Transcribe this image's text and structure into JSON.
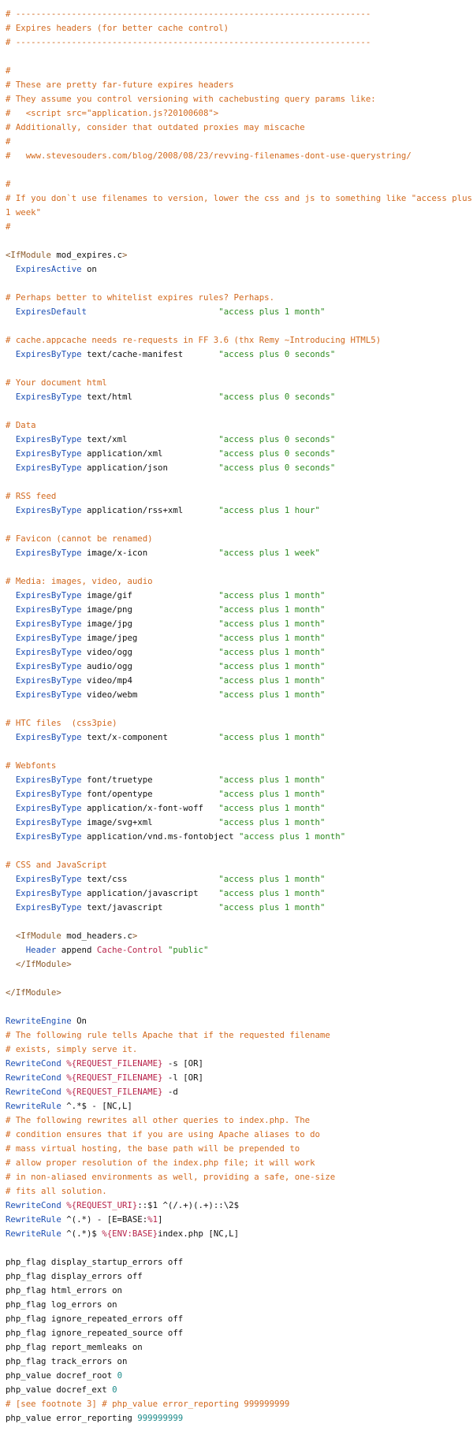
{
  "colors": {
    "comment": "#d2691e",
    "directive": "#1c4fb4",
    "string": "#2e8b22",
    "tag": "#8b5a2b",
    "number": "#1a8a8a",
    "variable": "#b8234a",
    "text": "#111111",
    "background": "#ffffff"
  },
  "lines": [
    [
      {
        "k": "c",
        "t": "# ----------------------------------------------------------------------"
      }
    ],
    [
      {
        "k": "c",
        "t": "# Expires headers (for better cache control)"
      }
    ],
    [
      {
        "k": "c",
        "t": "# ----------------------------------------------------------------------"
      }
    ],
    [],
    [
      {
        "k": "c",
        "t": "#"
      }
    ],
    [
      {
        "k": "c",
        "t": "# These are pretty far-future expires headers"
      }
    ],
    [
      {
        "k": "c",
        "t": "# They assume you control versioning with cachebusting query params like:"
      }
    ],
    [
      {
        "k": "c",
        "t": "#   <script src=\"application.js?20100608\">"
      }
    ],
    [
      {
        "k": "c",
        "t": "# Additionally, consider that outdated proxies may miscache"
      }
    ],
    [
      {
        "k": "c",
        "t": "#"
      }
    ],
    [
      {
        "k": "c",
        "t": "#   www.stevesouders.com/blog/2008/08/23/revving-filenames-dont-use-querystring/"
      }
    ],
    [],
    [
      {
        "k": "c",
        "t": "#"
      }
    ],
    [
      {
        "k": "c",
        "t": "# If you don`t use filenames to version, lower the css and js to something like \"access plus 1 week\""
      }
    ],
    [
      {
        "k": "c",
        "t": "#"
      }
    ],
    [],
    [
      {
        "k": "p",
        "t": "<IfModule"
      },
      {
        "k": "t",
        "t": " mod_expires.c"
      },
      {
        "k": "p",
        "t": ">"
      }
    ],
    [
      {
        "k": "t",
        "t": "  "
      },
      {
        "k": "k",
        "t": "ExpiresActive"
      },
      {
        "k": "t",
        "t": " on"
      }
    ],
    [],
    [
      {
        "k": "c",
        "t": "# Perhaps better to whitelist expires rules? Perhaps."
      }
    ],
    [
      {
        "k": "t",
        "t": "  "
      },
      {
        "k": "k",
        "t": "ExpiresDefault"
      },
      {
        "k": "t",
        "t": "                          "
      },
      {
        "k": "s",
        "t": "\"access plus 1 month\""
      }
    ],
    [],
    [
      {
        "k": "c",
        "t": "# cache.appcache needs re-requests in FF 3.6 (thx Remy ~Introducing HTML5)"
      }
    ],
    [
      {
        "k": "t",
        "t": "  "
      },
      {
        "k": "k",
        "t": "ExpiresByType"
      },
      {
        "k": "t",
        "t": " text/cache-manifest       "
      },
      {
        "k": "s",
        "t": "\"access plus 0 seconds\""
      }
    ],
    [],
    [
      {
        "k": "c",
        "t": "# Your document html"
      }
    ],
    [
      {
        "k": "t",
        "t": "  "
      },
      {
        "k": "k",
        "t": "ExpiresByType"
      },
      {
        "k": "t",
        "t": " text/html                 "
      },
      {
        "k": "s",
        "t": "\"access plus 0 seconds\""
      }
    ],
    [],
    [
      {
        "k": "c",
        "t": "# Data"
      }
    ],
    [
      {
        "k": "t",
        "t": "  "
      },
      {
        "k": "k",
        "t": "ExpiresByType"
      },
      {
        "k": "t",
        "t": " text/xml                  "
      },
      {
        "k": "s",
        "t": "\"access plus 0 seconds\""
      }
    ],
    [
      {
        "k": "t",
        "t": "  "
      },
      {
        "k": "k",
        "t": "ExpiresByType"
      },
      {
        "k": "t",
        "t": " application/xml           "
      },
      {
        "k": "s",
        "t": "\"access plus 0 seconds\""
      }
    ],
    [
      {
        "k": "t",
        "t": "  "
      },
      {
        "k": "k",
        "t": "ExpiresByType"
      },
      {
        "k": "t",
        "t": " application/json          "
      },
      {
        "k": "s",
        "t": "\"access plus 0 seconds\""
      }
    ],
    [],
    [
      {
        "k": "c",
        "t": "# RSS feed"
      }
    ],
    [
      {
        "k": "t",
        "t": "  "
      },
      {
        "k": "k",
        "t": "ExpiresByType"
      },
      {
        "k": "t",
        "t": " application/rss+xml       "
      },
      {
        "k": "s",
        "t": "\"access plus 1 hour\""
      }
    ],
    [],
    [
      {
        "k": "c",
        "t": "# Favicon (cannot be renamed)"
      }
    ],
    [
      {
        "k": "t",
        "t": "  "
      },
      {
        "k": "k",
        "t": "ExpiresByType"
      },
      {
        "k": "t",
        "t": " image/x-icon              "
      },
      {
        "k": "s",
        "t": "\"access plus 1 week\""
      }
    ],
    [],
    [
      {
        "k": "c",
        "t": "# Media: images, video, audio"
      }
    ],
    [
      {
        "k": "t",
        "t": "  "
      },
      {
        "k": "k",
        "t": "ExpiresByType"
      },
      {
        "k": "t",
        "t": " image/gif                 "
      },
      {
        "k": "s",
        "t": "\"access plus 1 month\""
      }
    ],
    [
      {
        "k": "t",
        "t": "  "
      },
      {
        "k": "k",
        "t": "ExpiresByType"
      },
      {
        "k": "t",
        "t": " image/png                 "
      },
      {
        "k": "s",
        "t": "\"access plus 1 month\""
      }
    ],
    [
      {
        "k": "t",
        "t": "  "
      },
      {
        "k": "k",
        "t": "ExpiresByType"
      },
      {
        "k": "t",
        "t": " image/jpg                 "
      },
      {
        "k": "s",
        "t": "\"access plus 1 month\""
      }
    ],
    [
      {
        "k": "t",
        "t": "  "
      },
      {
        "k": "k",
        "t": "ExpiresByType"
      },
      {
        "k": "t",
        "t": " image/jpeg                "
      },
      {
        "k": "s",
        "t": "\"access plus 1 month\""
      }
    ],
    [
      {
        "k": "t",
        "t": "  "
      },
      {
        "k": "k",
        "t": "ExpiresByType"
      },
      {
        "k": "t",
        "t": " video/ogg                 "
      },
      {
        "k": "s",
        "t": "\"access plus 1 month\""
      }
    ],
    [
      {
        "k": "t",
        "t": "  "
      },
      {
        "k": "k",
        "t": "ExpiresByType"
      },
      {
        "k": "t",
        "t": " audio/ogg                 "
      },
      {
        "k": "s",
        "t": "\"access plus 1 month\""
      }
    ],
    [
      {
        "k": "t",
        "t": "  "
      },
      {
        "k": "k",
        "t": "ExpiresByType"
      },
      {
        "k": "t",
        "t": " video/mp4                 "
      },
      {
        "k": "s",
        "t": "\"access plus 1 month\""
      }
    ],
    [
      {
        "k": "t",
        "t": "  "
      },
      {
        "k": "k",
        "t": "ExpiresByType"
      },
      {
        "k": "t",
        "t": " video/webm                "
      },
      {
        "k": "s",
        "t": "\"access plus 1 month\""
      }
    ],
    [],
    [
      {
        "k": "c",
        "t": "# HTC files  (css3pie)"
      }
    ],
    [
      {
        "k": "t",
        "t": "  "
      },
      {
        "k": "k",
        "t": "ExpiresByType"
      },
      {
        "k": "t",
        "t": " text/x-component          "
      },
      {
        "k": "s",
        "t": "\"access plus 1 month\""
      }
    ],
    [],
    [
      {
        "k": "c",
        "t": "# Webfonts"
      }
    ],
    [
      {
        "k": "t",
        "t": "  "
      },
      {
        "k": "k",
        "t": "ExpiresByType"
      },
      {
        "k": "t",
        "t": " font/truetype             "
      },
      {
        "k": "s",
        "t": "\"access plus 1 month\""
      }
    ],
    [
      {
        "k": "t",
        "t": "  "
      },
      {
        "k": "k",
        "t": "ExpiresByType"
      },
      {
        "k": "t",
        "t": " font/opentype             "
      },
      {
        "k": "s",
        "t": "\"access plus 1 month\""
      }
    ],
    [
      {
        "k": "t",
        "t": "  "
      },
      {
        "k": "k",
        "t": "ExpiresByType"
      },
      {
        "k": "t",
        "t": " application/x-font-woff   "
      },
      {
        "k": "s",
        "t": "\"access plus 1 month\""
      }
    ],
    [
      {
        "k": "t",
        "t": "  "
      },
      {
        "k": "k",
        "t": "ExpiresByType"
      },
      {
        "k": "t",
        "t": " image/svg+xml             "
      },
      {
        "k": "s",
        "t": "\"access plus 1 month\""
      }
    ],
    [
      {
        "k": "t",
        "t": "  "
      },
      {
        "k": "k",
        "t": "ExpiresByType"
      },
      {
        "k": "t",
        "t": " application/vnd.ms-fontobject "
      },
      {
        "k": "s",
        "t": "\"access plus 1 month\""
      }
    ],
    [],
    [
      {
        "k": "c",
        "t": "# CSS and JavaScript"
      }
    ],
    [
      {
        "k": "t",
        "t": "  "
      },
      {
        "k": "k",
        "t": "ExpiresByType"
      },
      {
        "k": "t",
        "t": " text/css                  "
      },
      {
        "k": "s",
        "t": "\"access plus 1 month\""
      }
    ],
    [
      {
        "k": "t",
        "t": "  "
      },
      {
        "k": "k",
        "t": "ExpiresByType"
      },
      {
        "k": "t",
        "t": " application/javascript    "
      },
      {
        "k": "s",
        "t": "\"access plus 1 month\""
      }
    ],
    [
      {
        "k": "t",
        "t": "  "
      },
      {
        "k": "k",
        "t": "ExpiresByType"
      },
      {
        "k": "t",
        "t": " text/javascript           "
      },
      {
        "k": "s",
        "t": "\"access plus 1 month\""
      }
    ],
    [],
    [
      {
        "k": "t",
        "t": "  "
      },
      {
        "k": "p",
        "t": "<IfModule"
      },
      {
        "k": "t",
        "t": " mod_headers.c"
      },
      {
        "k": "p",
        "t": ">"
      }
    ],
    [
      {
        "k": "t",
        "t": "    "
      },
      {
        "k": "k",
        "t": "Header"
      },
      {
        "k": "t",
        "t": " append "
      },
      {
        "k": "v",
        "t": "Cache-Control"
      },
      {
        "k": "t",
        "t": " "
      },
      {
        "k": "s",
        "t": "\"public\""
      }
    ],
    [
      {
        "k": "t",
        "t": "  "
      },
      {
        "k": "p",
        "t": "</IfModule>"
      }
    ],
    [],
    [
      {
        "k": "p",
        "t": "</IfModule>"
      }
    ],
    [],
    [
      {
        "k": "k",
        "t": "RewriteEngine"
      },
      {
        "k": "t",
        "t": " On"
      }
    ],
    [
      {
        "k": "c",
        "t": "# The following rule tells Apache that if the requested filename"
      }
    ],
    [
      {
        "k": "c",
        "t": "# exists, simply serve it."
      }
    ],
    [
      {
        "k": "k",
        "t": "RewriteCond"
      },
      {
        "k": "t",
        "t": " "
      },
      {
        "k": "v",
        "t": "%{REQUEST_FILENAME}"
      },
      {
        "k": "t",
        "t": " -s [OR]"
      }
    ],
    [
      {
        "k": "k",
        "t": "RewriteCond"
      },
      {
        "k": "t",
        "t": " "
      },
      {
        "k": "v",
        "t": "%{REQUEST_FILENAME}"
      },
      {
        "k": "t",
        "t": " -l [OR]"
      }
    ],
    [
      {
        "k": "k",
        "t": "RewriteCond"
      },
      {
        "k": "t",
        "t": " "
      },
      {
        "k": "v",
        "t": "%{REQUEST_FILENAME}"
      },
      {
        "k": "t",
        "t": " -d"
      }
    ],
    [
      {
        "k": "k",
        "t": "RewriteRule"
      },
      {
        "k": "t",
        "t": " ^.*$ - [NC,L]"
      }
    ],
    [
      {
        "k": "c",
        "t": "# The following rewrites all other queries to index.php. The"
      }
    ],
    [
      {
        "k": "c",
        "t": "# condition ensures that if you are using Apache aliases to do"
      }
    ],
    [
      {
        "k": "c",
        "t": "# mass virtual hosting, the base path will be prepended to"
      }
    ],
    [
      {
        "k": "c",
        "t": "# allow proper resolution of the index.php file; it will work"
      }
    ],
    [
      {
        "k": "c",
        "t": "# in non-aliased environments as well, providing a safe, one-size"
      }
    ],
    [
      {
        "k": "c",
        "t": "# fits all solution."
      }
    ],
    [
      {
        "k": "k",
        "t": "RewriteCond"
      },
      {
        "k": "t",
        "t": " "
      },
      {
        "k": "v",
        "t": "%{REQUEST_URI}"
      },
      {
        "k": "t",
        "t": "::$1 ^(/.+)(.+)::\\2$"
      }
    ],
    [
      {
        "k": "k",
        "t": "RewriteRule"
      },
      {
        "k": "t",
        "t": " ^(.*) - [E=BASE:"
      },
      {
        "k": "v",
        "t": "%1"
      },
      {
        "k": "t",
        "t": "]"
      }
    ],
    [
      {
        "k": "k",
        "t": "RewriteRule"
      },
      {
        "k": "t",
        "t": " ^(.*)$ "
      },
      {
        "k": "v",
        "t": "%{ENV:BASE}"
      },
      {
        "k": "t",
        "t": "index.php [NC,L]"
      }
    ],
    [],
    [
      {
        "k": "t",
        "t": "php_flag display_startup_errors off"
      }
    ],
    [
      {
        "k": "t",
        "t": "php_flag display_errors off"
      }
    ],
    [
      {
        "k": "t",
        "t": "php_flag html_errors on"
      }
    ],
    [
      {
        "k": "t",
        "t": "php_flag log_errors on"
      }
    ],
    [
      {
        "k": "t",
        "t": "php_flag ignore_repeated_errors off"
      }
    ],
    [
      {
        "k": "t",
        "t": "php_flag ignore_repeated_source off"
      }
    ],
    [
      {
        "k": "t",
        "t": "php_flag report_memleaks on"
      }
    ],
    [
      {
        "k": "t",
        "t": "php_flag track_errors on"
      }
    ],
    [
      {
        "k": "t",
        "t": "php_value docref_root "
      },
      {
        "k": "n",
        "t": "0"
      }
    ],
    [
      {
        "k": "t",
        "t": "php_value docref_ext "
      },
      {
        "k": "n",
        "t": "0"
      }
    ],
    [
      {
        "k": "c",
        "t": "# [see footnote 3] # php_value error_reporting 999999999"
      }
    ],
    [
      {
        "k": "t",
        "t": "php_value error_reporting "
      },
      {
        "k": "n",
        "t": "999999999"
      }
    ]
  ]
}
